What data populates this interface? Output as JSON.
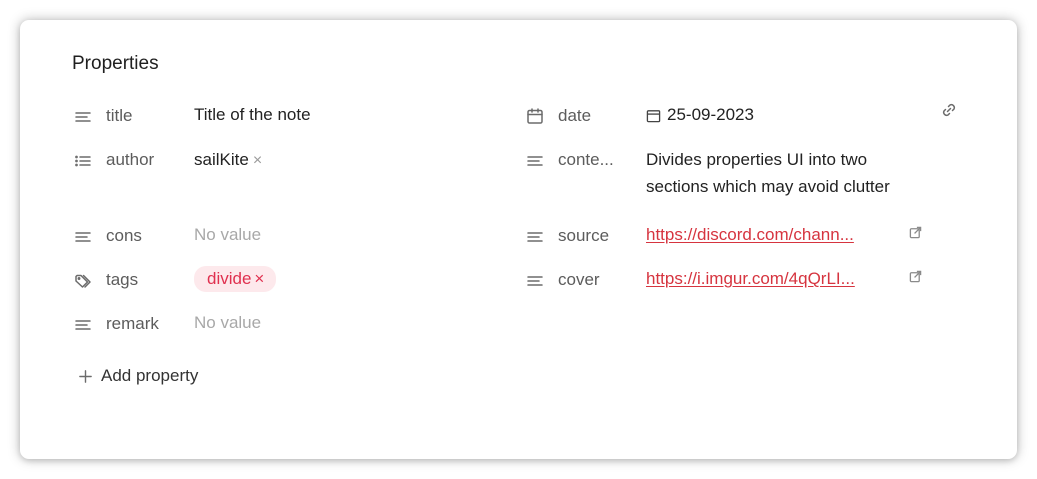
{
  "panel": {
    "title": "Properties",
    "add_property_label": "Add property"
  },
  "left": [
    {
      "icon": "text-lines-icon",
      "name": "title",
      "value": "Title of the note"
    },
    {
      "icon": "list-icon",
      "name": "author",
      "value": "sailKite",
      "remove": "×"
    },
    {
      "icon": "text-lines-icon",
      "name": "cons",
      "value": "No value"
    },
    {
      "icon": "tag-icon",
      "name": "tags",
      "value": "divide",
      "remove": "×"
    },
    {
      "icon": "text-lines-icon",
      "name": "remark",
      "value": "No value"
    }
  ],
  "right": [
    {
      "icon": "calendar-icon",
      "name": "date",
      "value": "25-09-2023"
    },
    {
      "icon": "text-lines-icon",
      "name": "conte...",
      "value_line1": "Divides properties UI into two",
      "value_line2": "sections which may avoid clutter"
    },
    {
      "icon": "text-lines-icon",
      "name": "source",
      "value": "https://discord.com/chann..."
    },
    {
      "icon": "text-lines-icon",
      "name": "cover",
      "value": "https://i.imgur.com/4qQrLI..."
    }
  ],
  "colors": {
    "accent": "#d6343f",
    "tag_bg": "#fde9ec",
    "muted": "#a8a8a8"
  }
}
